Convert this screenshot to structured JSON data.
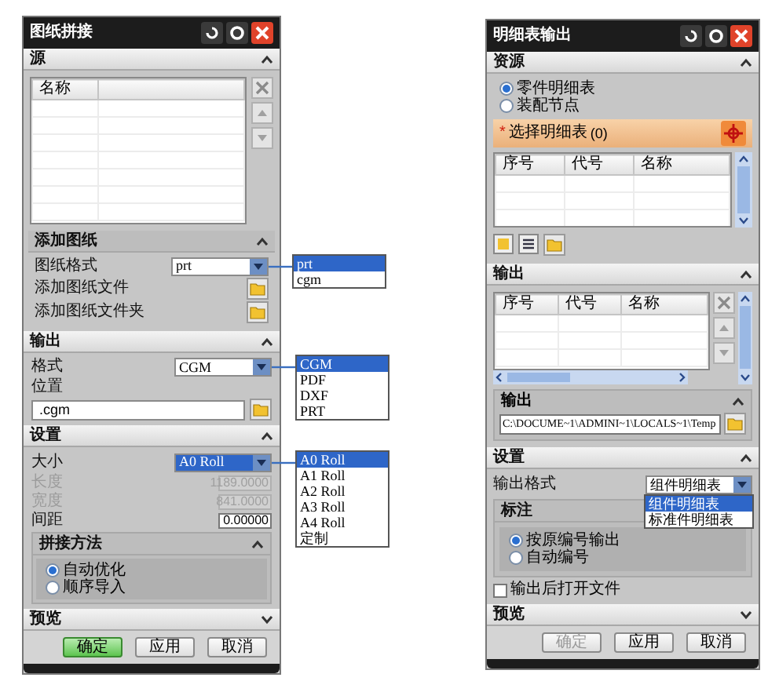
{
  "left_dialog": {
    "title": "图纸拼接",
    "source": {
      "header": "源",
      "expanded": true,
      "columns": [
        "名称"
      ]
    },
    "add_drawing": {
      "header": "添加图纸",
      "expanded": true,
      "format_label": "图纸格式",
      "format_value": "prt",
      "format_options": [
        {
          "label": "prt",
          "selected": true
        },
        {
          "label": "cgm",
          "selected": false
        }
      ],
      "add_file": "添加图纸文件",
      "add_folder": "添加图纸文件夹"
    },
    "output": {
      "header": "输出",
      "expanded": true,
      "format_label": "格式",
      "format_value": "CGM",
      "format_options": [
        {
          "label": "CGM",
          "selected": true
        },
        {
          "label": "PDF",
          "selected": false
        },
        {
          "label": "DXF",
          "selected": false
        },
        {
          "label": "PRT",
          "selected": false
        }
      ],
      "location_label": "位置",
      "location_value": ".cgm"
    },
    "settings": {
      "header": "设置",
      "expanded": true,
      "size_label": "大小",
      "size_value": "A0 Roll",
      "size_options": [
        {
          "label": "A0 Roll",
          "selected": true
        },
        {
          "label": "A1 Roll",
          "selected": false
        },
        {
          "label": "A2 Roll",
          "selected": false
        },
        {
          "label": "A3 Roll",
          "selected": false
        },
        {
          "label": "A4 Roll",
          "selected": false
        },
        {
          "label": "定制",
          "selected": false
        }
      ],
      "fields": [
        {
          "label": "长度",
          "value": "1189.0000",
          "disabled": true
        },
        {
          "label": "宽度",
          "value": "841.0000",
          "disabled": true
        },
        {
          "label": "间距",
          "value": "0.00000",
          "disabled": false
        }
      ],
      "method": {
        "header": "拼接方法",
        "expanded": true,
        "options": [
          {
            "label": "自动优化",
            "selected": true
          },
          {
            "label": "顺序导入",
            "selected": false
          }
        ]
      }
    },
    "preview": {
      "header": "预览",
      "expanded": false
    },
    "buttons": [
      {
        "label": "确定",
        "primary": true,
        "disabled": false
      },
      {
        "label": "应用",
        "primary": false,
        "disabled": false
      },
      {
        "label": "取消",
        "primary": false,
        "disabled": false
      }
    ]
  },
  "right_dialog": {
    "title": "明细表输出",
    "source": {
      "header": "资源",
      "expanded": true,
      "options": [
        {
          "label": "零件明细表",
          "selected": true
        },
        {
          "label": "装配节点",
          "selected": false
        }
      ],
      "select_mark": "*",
      "select_label": "选择明细表",
      "select_count": "(0)",
      "columns": [
        "序号",
        "代号",
        "名称"
      ]
    },
    "output": {
      "header": "输出",
      "expanded": true,
      "columns": [
        "序号",
        "代号",
        "名称"
      ],
      "path_header": "输出",
      "path_value": "C:\\DOCUME~1\\ADMINI~1\\LOCALS~1\\Temp"
    },
    "settings": {
      "header": "设置",
      "expanded": true,
      "format_label": "输出格式",
      "format_value": "组件明细表",
      "format_options": [
        {
          "label": "组件明细表",
          "selected": true
        },
        {
          "label": "标准件明细表",
          "selected": false
        }
      ],
      "numbering": {
        "header": "标注",
        "expanded": true,
        "options": [
          {
            "label": "按原编号输出",
            "selected": true
          },
          {
            "label": "自动编号",
            "selected": false
          }
        ]
      },
      "open_after": {
        "label": "输出后打开文件",
        "checked": false
      }
    },
    "preview": {
      "header": "预览",
      "expanded": false
    },
    "buttons": [
      {
        "label": "确定",
        "primary": false,
        "disabled": true
      },
      {
        "label": "应用",
        "primary": false,
        "disabled": false
      },
      {
        "label": "取消",
        "primary": false,
        "disabled": false
      }
    ]
  }
}
